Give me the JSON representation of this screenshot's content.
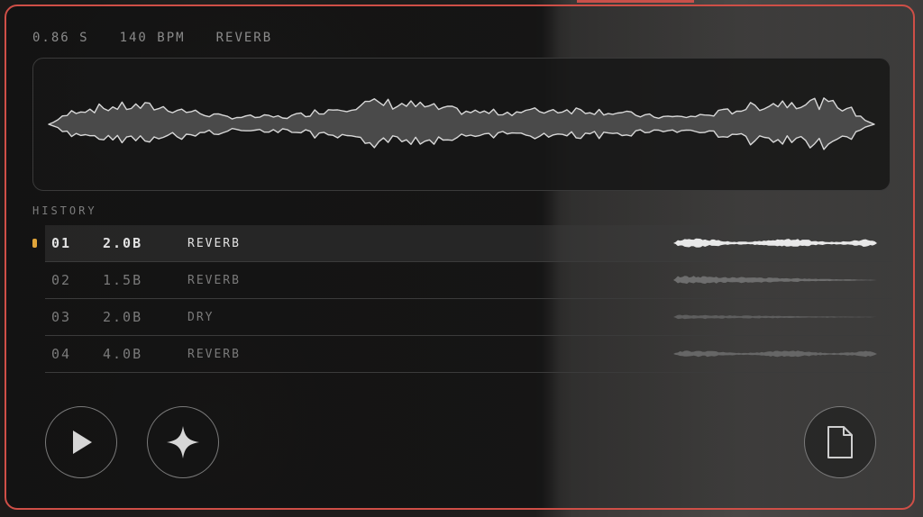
{
  "header": {
    "duration": "0.86 S",
    "tempo": "140 BPM",
    "effect": "REVERB"
  },
  "history": {
    "label": "HISTORY",
    "rows": [
      {
        "index": "01",
        "size": "2.0B",
        "effect": "REVERB",
        "active": true
      },
      {
        "index": "02",
        "size": "1.5B",
        "effect": "REVERB",
        "active": false
      },
      {
        "index": "03",
        "size": "2.0B",
        "effect": "DRY",
        "active": false
      },
      {
        "index": "04",
        "size": "4.0B",
        "effect": "REVERB",
        "active": false
      }
    ]
  },
  "controls": {
    "play_icon": "play-icon",
    "sparkle_icon": "sparkle-icon",
    "file_icon": "file-icon"
  },
  "colors": {
    "accent_border": "#cf4f47",
    "active_marker": "#e0a43a"
  }
}
